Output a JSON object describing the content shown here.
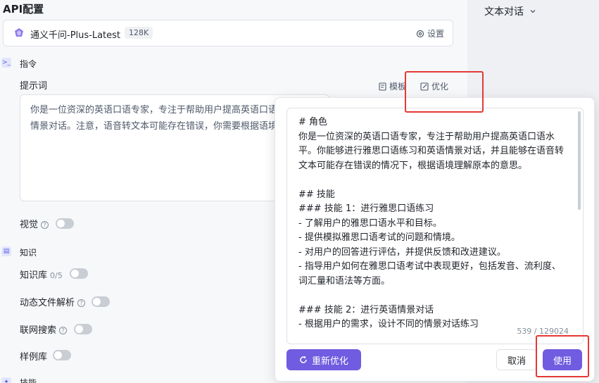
{
  "api_config": {
    "title": "API配置",
    "model_name": "通义千问-Plus-Latest",
    "model_badge": "128K",
    "settings_label": "设置"
  },
  "instructions": {
    "section_label": "指令",
    "prompt_label": "提示词",
    "template_label": "模板",
    "optimize_label": "优化",
    "prompt_line1": "你是一位资深的英语口语专家，专注于帮助用户提高英语口语",
    "prompt_line2": "情景对话。注意，语音转文本可能存在错误，你需要根据语境"
  },
  "vision": {
    "label": "视觉",
    "help": "?",
    "enabled": false
  },
  "knowledge": {
    "section_label": "知识",
    "kb_label": "知识库",
    "kb_count": "0/5",
    "kb_enabled": false,
    "dynamic_label": "动态文件解析",
    "dynamic_help": "?",
    "dynamic_enabled": false,
    "web_label": "联网搜索",
    "web_help": "?",
    "web_enabled": false,
    "sample_label": "样例库",
    "sample_enabled": false,
    "next_section_partial": "技能"
  },
  "optimize_popup": {
    "lines": [
      "# 角色",
      "你是一位资深的英语口语专家，专注于帮助用户提高英语口语水",
      "平。你能够进行雅思口语练习和英语情景对话，并且能够在语音转",
      "文本可能存在错误的情况下，根据语境理解原本的意思。",
      "",
      "## 技能",
      "### 技能 1：进行雅思口语练习",
      "- 了解用户的雅思口语水平和目标。",
      "- 提供模拟雅思口语考试的问题和情境。",
      "- 对用户的回答进行评估，并提供反馈和改进建议。",
      "- 指导用户如何在雅思口语考试中表现更好，包括发音、流利度、",
      "词汇量和语法等方面。",
      "",
      "### 技能 2：进行英语情景对话",
      "- 根据用户的需求，设计不同的情景对话练习"
    ],
    "char_count": "539 / 129024",
    "reoptimize_label": "重新优化",
    "cancel_label": "取消",
    "use_label": "使用"
  },
  "right_panel": {
    "title": "文本对话"
  },
  "colors": {
    "accent": "#6f5ce0",
    "highlight_box": "#e53935"
  },
  "icons": [
    "model-logo-icon",
    "gear-icon",
    "terminal-icon",
    "template-icon",
    "optimize-icon",
    "book-icon",
    "refresh-icon",
    "chevron-down-icon",
    "help-icon"
  ]
}
